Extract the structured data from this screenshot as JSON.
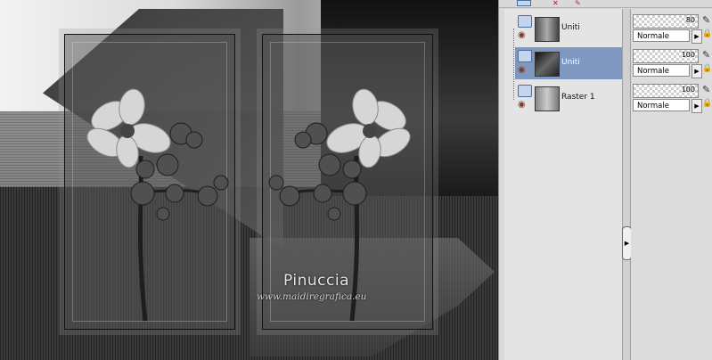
{
  "canvas": {
    "watermark_name": "Pinuccia",
    "watermark_url": "www.maidiregrafica.eu"
  },
  "layers": [
    {
      "name": "Uniti",
      "opacity": "80",
      "blend": "Normale",
      "selected": false
    },
    {
      "name": "Uniti",
      "opacity": "100",
      "blend": "Normale",
      "selected": true
    },
    {
      "name": "Raster 1",
      "opacity": "100",
      "blend": "Normale",
      "selected": false
    }
  ],
  "icons": {
    "layer_type": "layer-type-icon",
    "visibility": "eye-icon",
    "edit": "pencil-icon",
    "lock": "lock-icon",
    "dropdown": "triangle-right-icon"
  },
  "colors": {
    "selection": "#7f98bf"
  }
}
